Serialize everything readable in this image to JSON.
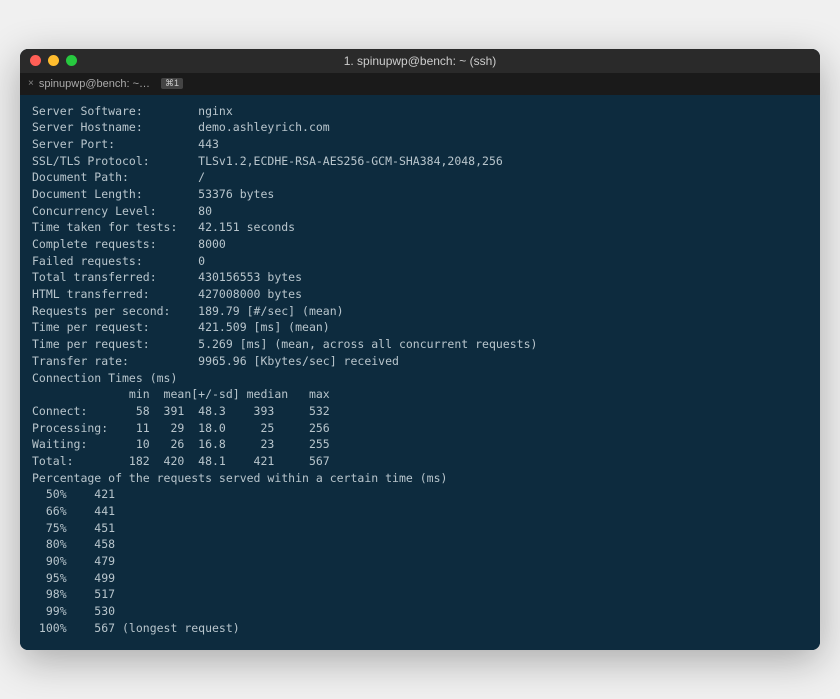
{
  "window": {
    "title": "1. spinupwp@bench: ~ (ssh)"
  },
  "tab": {
    "close": "×",
    "label": "spinupwp@bench: ~…",
    "shortcut": "⌘1"
  },
  "info": [
    {
      "label": "Server Software:",
      "value": "nginx"
    },
    {
      "label": "Server Hostname:",
      "value": "demo.ashleyrich.com"
    },
    {
      "label": "Server Port:",
      "value": "443"
    },
    {
      "label": "SSL/TLS Protocol:",
      "value": "TLSv1.2,ECDHE-RSA-AES256-GCM-SHA384,2048,256"
    }
  ],
  "doc": [
    {
      "label": "Document Path:",
      "value": "/"
    },
    {
      "label": "Document Length:",
      "value": "53376 bytes"
    }
  ],
  "stats": [
    {
      "label": "Concurrency Level:",
      "value": "80"
    },
    {
      "label": "Time taken for tests:",
      "value": "42.151 seconds"
    },
    {
      "label": "Complete requests:",
      "value": "8000"
    },
    {
      "label": "Failed requests:",
      "value": "0"
    },
    {
      "label": "Total transferred:",
      "value": "430156553 bytes"
    },
    {
      "label": "HTML transferred:",
      "value": "427008000 bytes"
    },
    {
      "label": "Requests per second:",
      "value": "189.79 [#/sec] (mean)"
    },
    {
      "label": "Time per request:",
      "value": "421.509 [ms] (mean)"
    },
    {
      "label": "Time per request:",
      "value": "5.269 [ms] (mean, across all concurrent requests)"
    },
    {
      "label": "Transfer rate:",
      "value": "9965.96 [Kbytes/sec] received"
    }
  ],
  "conn_title": "Connection Times (ms)",
  "conn_header": "              min  mean[+/-sd] median   max",
  "conn_rows": [
    {
      "name": "Connect:",
      "min": "58",
      "mean": "391",
      "sd": "48.3",
      "median": "393",
      "max": "532"
    },
    {
      "name": "Processing:",
      "min": "11",
      "mean": "29",
      "sd": "18.0",
      "median": "25",
      "max": "256"
    },
    {
      "name": "Waiting:",
      "min": "10",
      "mean": "26",
      "sd": "16.8",
      "median": "23",
      "max": "255"
    },
    {
      "name": "Total:",
      "min": "182",
      "mean": "420",
      "sd": "48.1",
      "median": "421",
      "max": "567"
    }
  ],
  "pct_title": "Percentage of the requests served within a certain time (ms)",
  "pct_rows": [
    {
      "pct": "50%",
      "val": "421",
      "note": ""
    },
    {
      "pct": "66%",
      "val": "441",
      "note": ""
    },
    {
      "pct": "75%",
      "val": "451",
      "note": ""
    },
    {
      "pct": "80%",
      "val": "458",
      "note": ""
    },
    {
      "pct": "90%",
      "val": "479",
      "note": ""
    },
    {
      "pct": "95%",
      "val": "499",
      "note": ""
    },
    {
      "pct": "98%",
      "val": "517",
      "note": ""
    },
    {
      "pct": "99%",
      "val": "530",
      "note": ""
    },
    {
      "pct": "100%",
      "val": "567",
      "note": " (longest request)"
    }
  ]
}
